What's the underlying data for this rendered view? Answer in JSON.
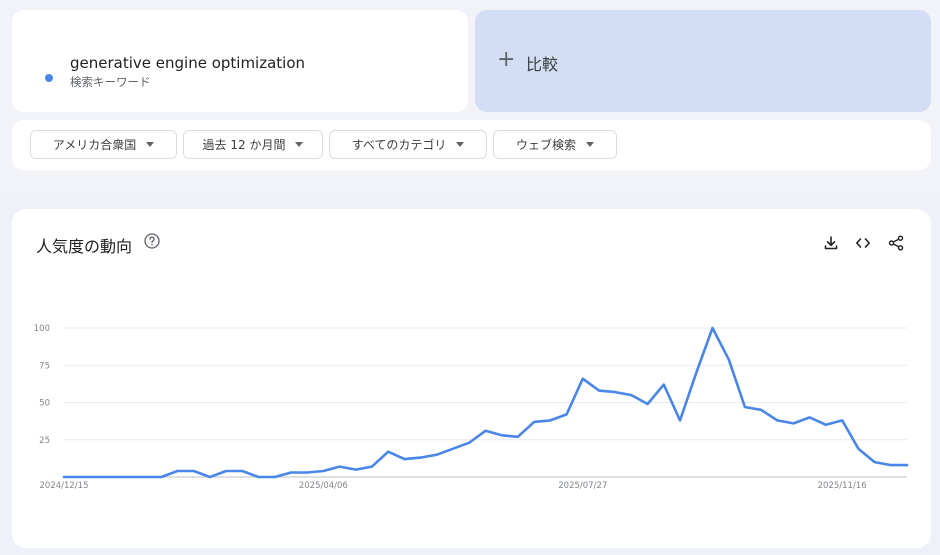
{
  "search_term": {
    "name": "generative engine optimization",
    "type": "検索キーワード",
    "color": "#4a86e8"
  },
  "compare": {
    "plus": "+",
    "label": "比較"
  },
  "filters": [
    {
      "label": "アメリカ合衆国"
    },
    {
      "label": "過去 12 か月間"
    },
    {
      "label": "すべてのカテゴリ"
    },
    {
      "label": "ウェブ検索"
    }
  ],
  "chart_card": {
    "title": "人気度の動向",
    "help_icon": "help-circle-icon",
    "tools": [
      "download-icon",
      "embed-code-icon",
      "share-icon"
    ]
  },
  "chart_data": {
    "type": "line",
    "ylim": [
      0,
      100
    ],
    "y_ticks": [
      25,
      50,
      75,
      100
    ],
    "x_tick_labels": [
      {
        "label": "2024/12/15",
        "index": 0
      },
      {
        "label": "2025/04/06",
        "index": 16
      },
      {
        "label": "2025/07/27",
        "index": 32
      },
      {
        "label": "2025/11/16",
        "index": 48
      }
    ],
    "grid": true,
    "series": [
      {
        "color": "#4a86e8",
        "values": [
          0,
          0,
          0,
          0,
          0,
          0,
          0,
          4,
          4,
          0,
          4,
          4,
          0,
          0,
          3,
          3,
          4,
          7,
          5,
          7,
          17,
          12,
          13,
          15,
          19,
          23,
          31,
          28,
          27,
          37,
          38,
          42,
          66,
          58,
          57,
          55,
          49,
          62,
          38,
          70,
          100,
          79,
          47,
          45,
          38,
          36,
          40,
          35,
          38,
          19,
          10,
          8,
          8
        ]
      }
    ]
  }
}
